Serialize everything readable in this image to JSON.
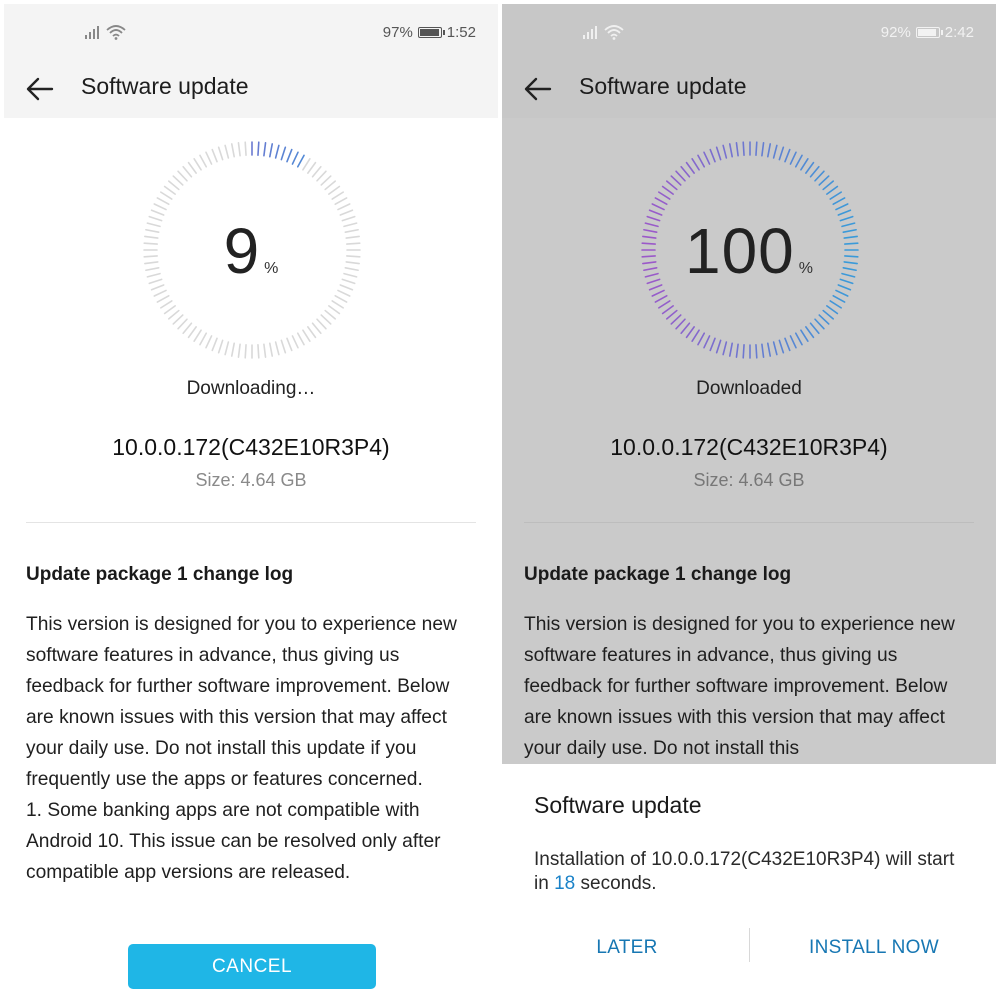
{
  "left": {
    "status": {
      "battery": "97%",
      "time": "1:52",
      "battery_level": 0.97
    },
    "appbar": {
      "title": "Software update"
    },
    "progress": {
      "value": "9",
      "unit": "%",
      "fraction": 0.09
    },
    "status_text": "Downloading…",
    "version": "10.0.0.172(C432E10R3P4)",
    "size": "Size: 4.64 GB",
    "changelog": {
      "title": "Update package 1 change log",
      "text": "This version is designed for you to experience new software features in advance, thus giving us feedback for further software improvement. Below are known issues with this version that may affect your daily use. Do not install this update if you frequently use the apps or features concerned.\n1. Some banking apps are not compatible with Android 10. This issue can be resolved only after compatible app versions are released."
    },
    "cancel_label": "CANCEL"
  },
  "right": {
    "status": {
      "battery": "92%",
      "time": "2:42",
      "battery_level": 0.92
    },
    "appbar": {
      "title": "Software update"
    },
    "progress": {
      "value": "100",
      "unit": "%",
      "fraction": 1.0
    },
    "status_text": "Downloaded",
    "version": "10.0.0.172(C432E10R3P4)",
    "size": "Size: 4.64 GB",
    "changelog": {
      "title": "Update package 1 change log",
      "text": "This version is designed for you to experience new software features in advance, thus giving us feedback for further software improvement. Below are known issues with this version that may affect your daily use. Do not install this"
    },
    "dialog": {
      "title": "Software update",
      "message_prefix": "Installation of 10.0.0.172(C432E10R3P4) will start in ",
      "countdown": "18",
      "message_suffix": " seconds.",
      "later_label": "LATER",
      "install_label": "INSTALL NOW"
    }
  },
  "colors": {
    "accent": "#1fb6e6",
    "dialog_button": "#1777b3",
    "ring_gradient_start": "#9b59c9",
    "ring_gradient_end": "#3a9ad9",
    "ring_idle": "#d9d9d9"
  },
  "icons": [
    "signal-icon",
    "wifi-icon",
    "battery-icon",
    "back-arrow-icon"
  ]
}
